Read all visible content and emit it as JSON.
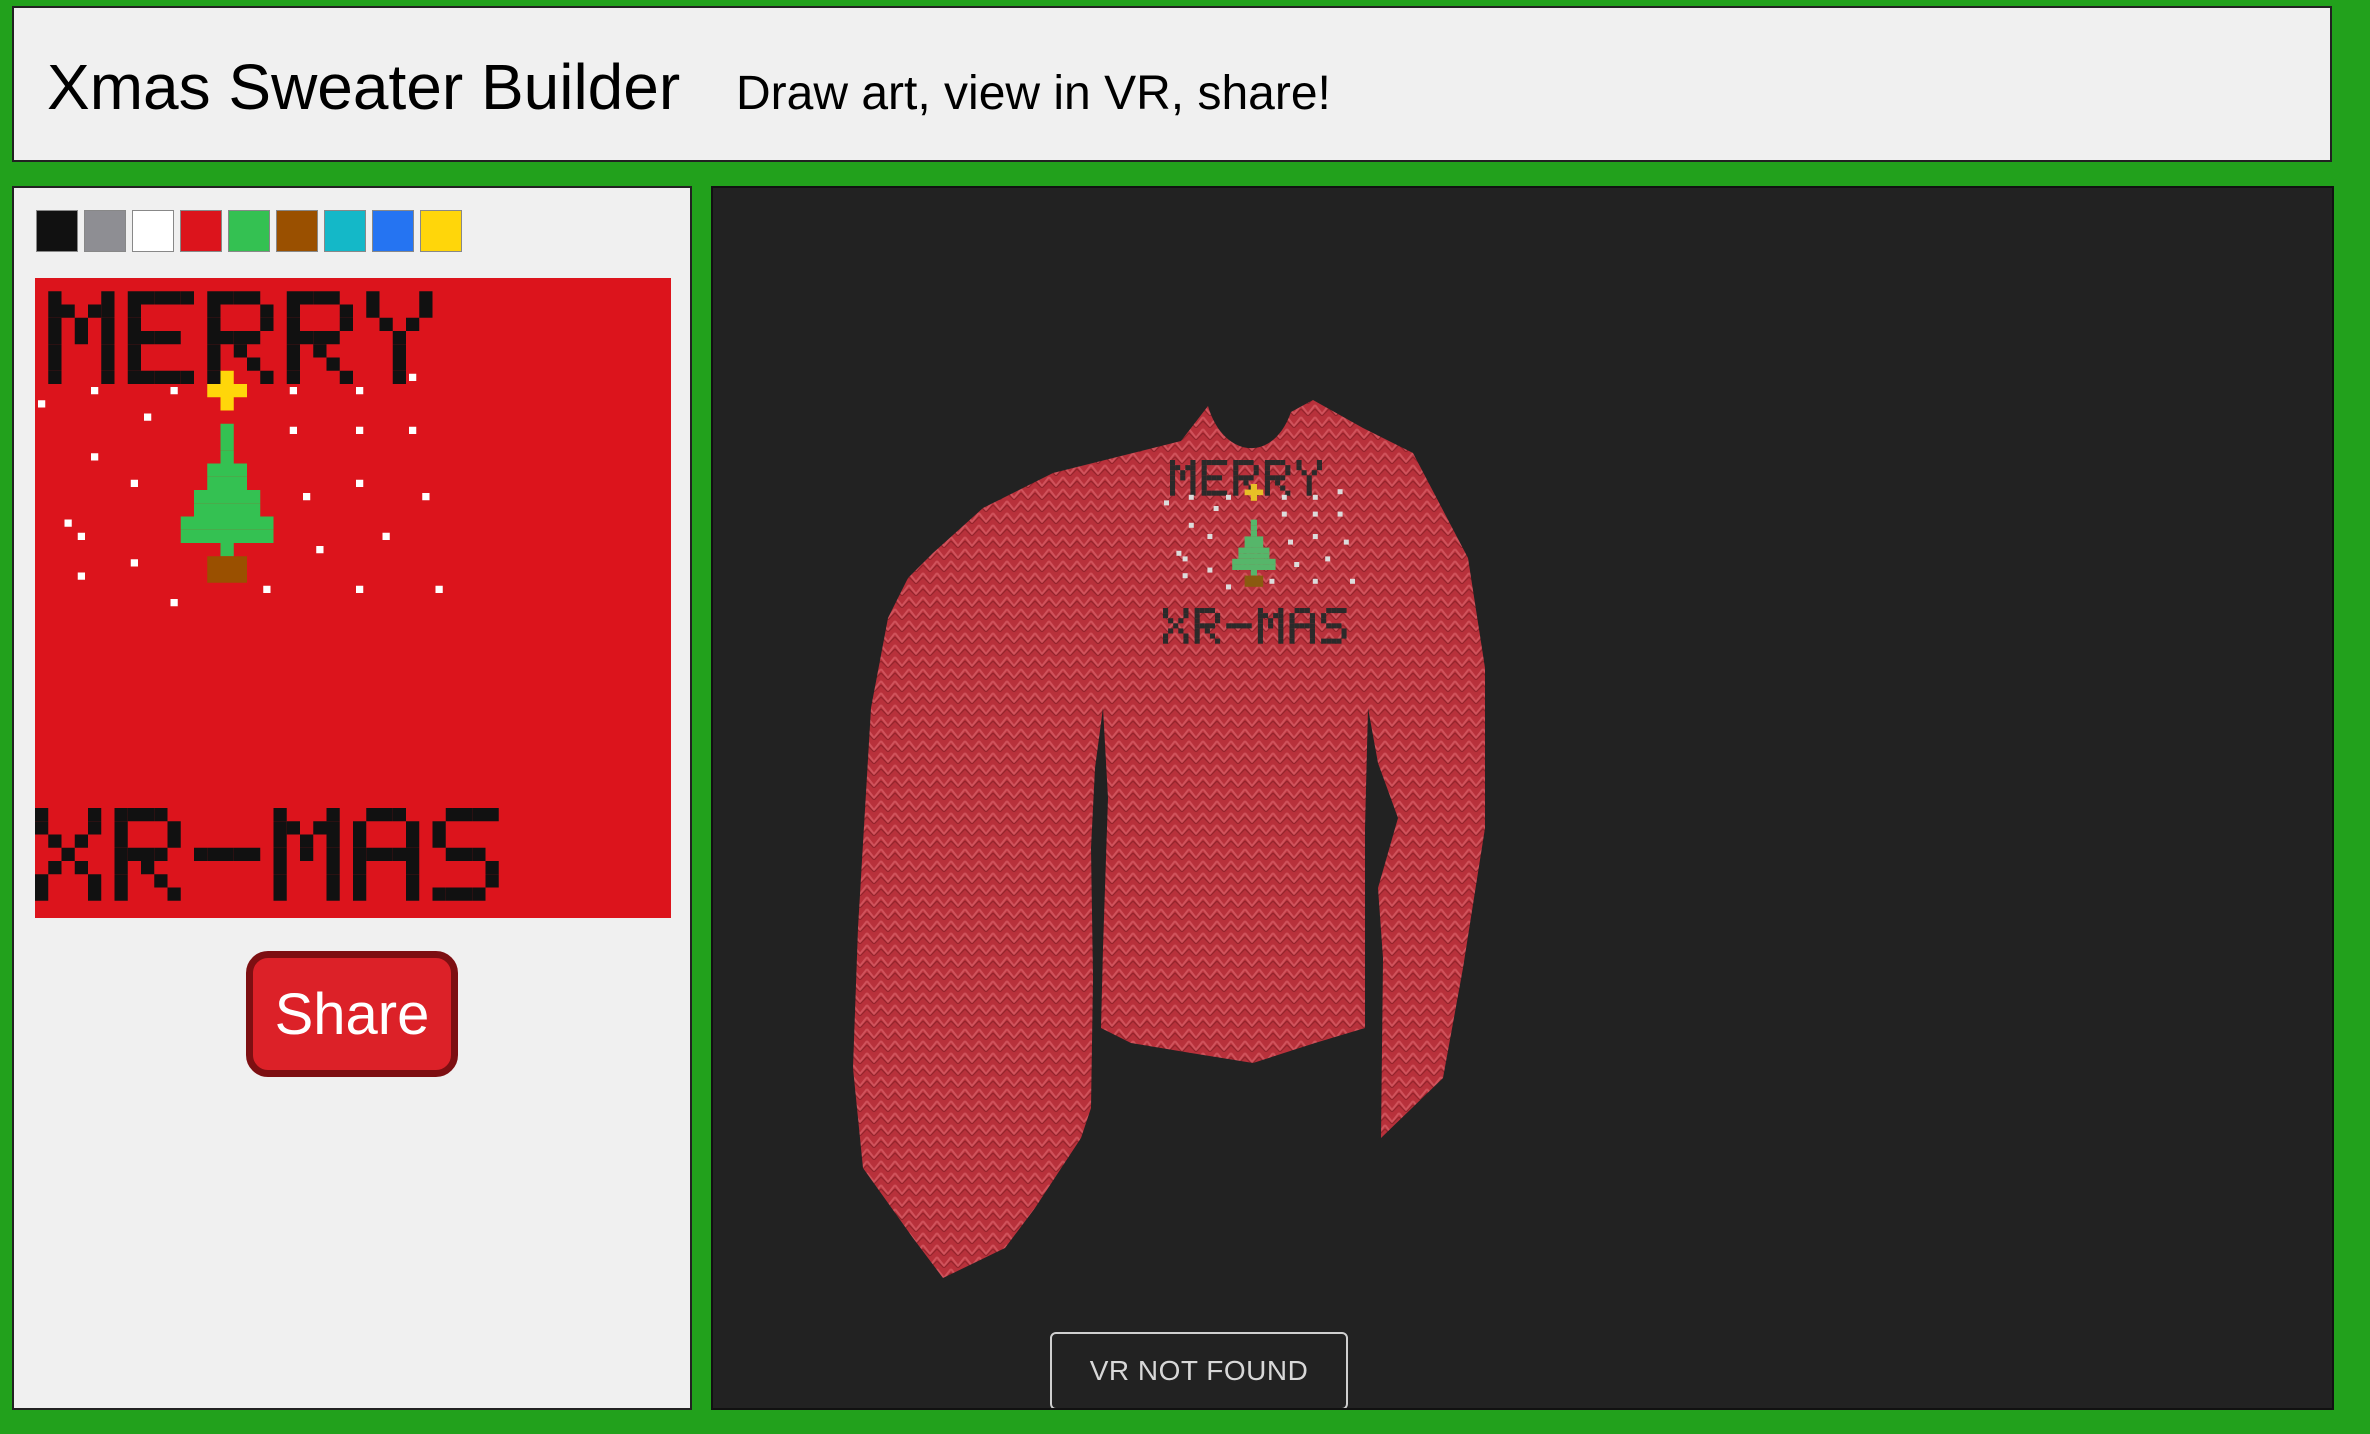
{
  "app": {
    "title": "Xmas Sweater Builder",
    "subtitle": "Draw art, view in VR, share!"
  },
  "palette": {
    "colors": [
      "#111111",
      "#8e8e93",
      "#ffffff",
      "#dc141c",
      "#34c152",
      "#9a5000",
      "#14b8c8",
      "#2574f2",
      "#ffd60a"
    ]
  },
  "art": {
    "background_color": "#dc141c",
    "top_text": "MERRY",
    "bottom_text": "XR-MAS",
    "text_color": "#111111",
    "snow_color": "#ffffff",
    "tree_color": "#34c152",
    "star_color": "#ffd60a",
    "trunk_color": "#9a5000"
  },
  "actions": {
    "share_label": "Share"
  },
  "viewport": {
    "background_color": "#222222",
    "sweater_color": "#b8313b",
    "vr_button_label": "VR NOT FOUND"
  }
}
